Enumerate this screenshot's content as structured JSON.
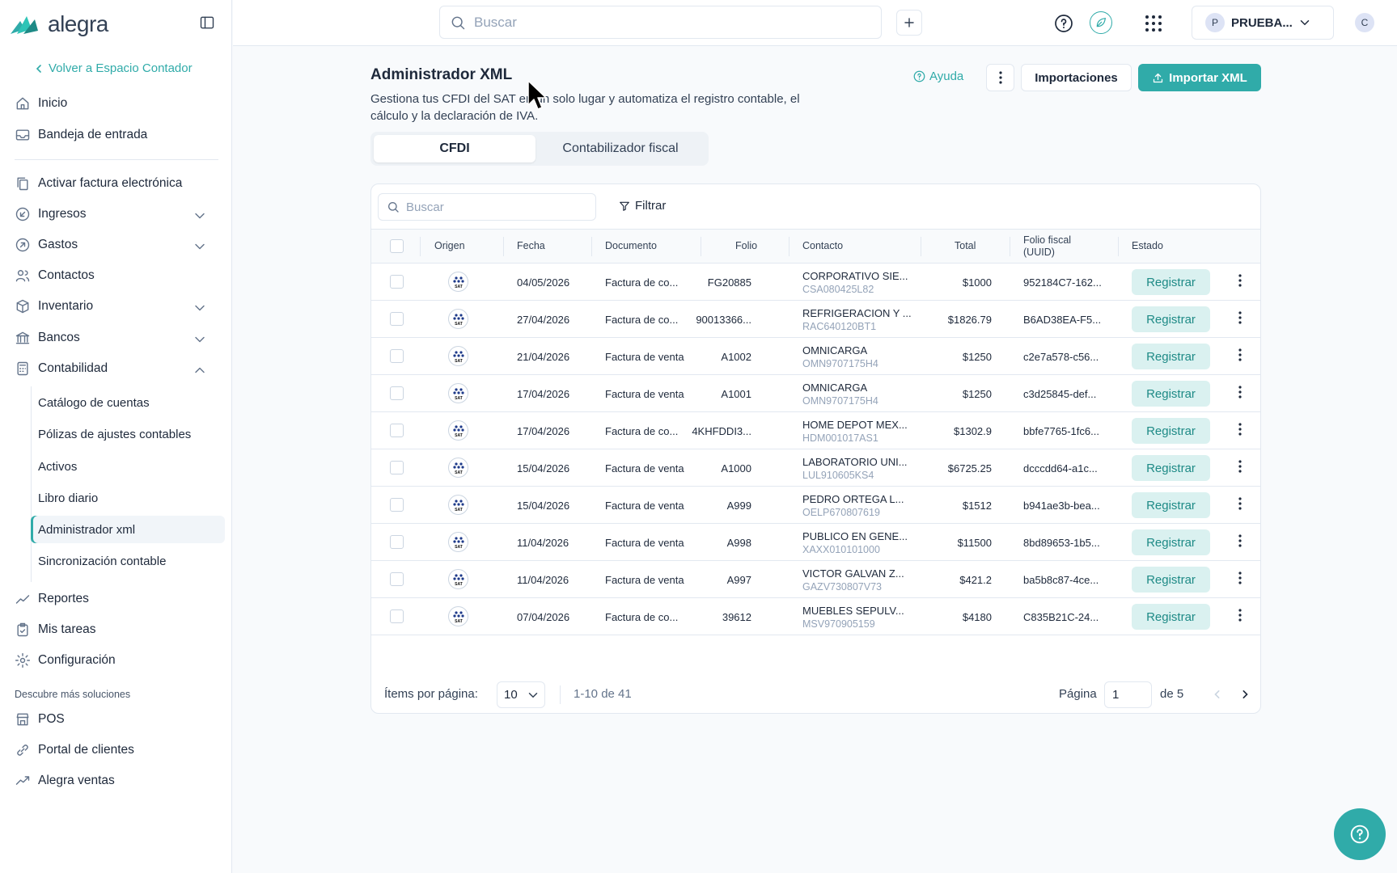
{
  "app": {
    "logo_text": "alegra"
  },
  "sidebar": {
    "back_link": "Volver a Espacio Contador",
    "top_items": [
      {
        "label": "Inicio",
        "icon": "home-icon"
      },
      {
        "label": "Bandeja de entrada",
        "icon": "inbox-icon"
      }
    ],
    "items": [
      {
        "label": "Activar factura electrónica",
        "icon": "document-copy-icon"
      },
      {
        "label": "Ingresos",
        "icon": "income-icon"
      },
      {
        "label": "Gastos",
        "icon": "expense-icon"
      },
      {
        "label": "Contactos",
        "icon": "contacts-icon"
      },
      {
        "label": "Inventario",
        "icon": "box-icon"
      },
      {
        "label": "Bancos",
        "icon": "bank-icon"
      },
      {
        "label": "Contabilidad",
        "icon": "calculator-icon"
      }
    ],
    "accounting_sub": [
      {
        "label": "Catálogo de cuentas"
      },
      {
        "label": "Pólizas de ajustes contables"
      },
      {
        "label": "Activos"
      },
      {
        "label": "Libro diario"
      },
      {
        "label": "Administrador xml",
        "active": true
      },
      {
        "label": "Sincronización contable"
      }
    ],
    "bottom_items": [
      {
        "label": "Reportes",
        "icon": "chart-icon"
      },
      {
        "label": "Mis tareas",
        "icon": "clipboard-icon"
      },
      {
        "label": "Configuración",
        "icon": "gear-icon"
      }
    ],
    "discover_label": "Descubre más soluciones",
    "solutions": [
      {
        "label": "POS",
        "icon": "store-icon"
      },
      {
        "label": "Portal de clientes",
        "icon": "link-icon"
      },
      {
        "label": "Alegra ventas",
        "icon": "trend-icon"
      }
    ]
  },
  "topbar": {
    "search_placeholder": "Buscar",
    "company_initial": "P",
    "company_name": "PRUEBA...",
    "user_initial": "C"
  },
  "page": {
    "title": "Administrador XML",
    "description": "Gestiona tus CFDI del SAT en un solo lugar y automatiza el registro contable, el cálculo y la declaración de IVA.",
    "help_label": "Ayuda",
    "imports_label": "Importaciones",
    "import_xml_label": "Importar XML"
  },
  "tabs": [
    {
      "label": "CFDI",
      "active": true
    },
    {
      "label": "Contabilizador fiscal",
      "active": false
    }
  ],
  "table": {
    "search_placeholder": "Buscar",
    "filter_label": "Filtrar",
    "columns": {
      "origen": "Origen",
      "fecha": "Fecha",
      "documento": "Documento",
      "folio": "Folio",
      "contacto": "Contacto",
      "total": "Total",
      "uuid_line1": "Folio fiscal",
      "uuid_line2": "(UUID)",
      "estado": "Estado"
    },
    "origin_badge": "SAT",
    "rows": [
      {
        "fecha": "04/05/2026",
        "documento": "Factura de co...",
        "folio": "FG20885",
        "contacto": "CORPORATIVO SIE...",
        "rfc": "CSA080425L82",
        "total": "$1000",
        "uuid": "952184C7-162...",
        "estado": "Registrar"
      },
      {
        "fecha": "27/04/2026",
        "documento": "Factura de co...",
        "folio": "90013366...",
        "contacto": "REFRIGERACION Y ...",
        "rfc": "RAC640120BT1",
        "total": "$1826.79",
        "uuid": "B6AD38EA-F5...",
        "estado": "Registrar"
      },
      {
        "fecha": "21/04/2026",
        "documento": "Factura de venta",
        "folio": "A1002",
        "contacto": "OMNICARGA",
        "rfc": "OMN9707175H4",
        "total": "$1250",
        "uuid": "c2e7a578-c56...",
        "estado": "Registrar"
      },
      {
        "fecha": "17/04/2026",
        "documento": "Factura de venta",
        "folio": "A1001",
        "contacto": "OMNICARGA",
        "rfc": "OMN9707175H4",
        "total": "$1250",
        "uuid": "c3d25845-def...",
        "estado": "Registrar"
      },
      {
        "fecha": "17/04/2026",
        "documento": "Factura de co...",
        "folio": "4KHFDDI3...",
        "contacto": "HOME DEPOT MEX...",
        "rfc": "HDM001017AS1",
        "total": "$1302.9",
        "uuid": "bbfe7765-1fc6...",
        "estado": "Registrar"
      },
      {
        "fecha": "15/04/2026",
        "documento": "Factura de venta",
        "folio": "A1000",
        "contacto": "LABORATORIO UNI...",
        "rfc": "LUL910605KS4",
        "total": "$6725.25",
        "uuid": "dcccdd64-a1c...",
        "estado": "Registrar"
      },
      {
        "fecha": "15/04/2026",
        "documento": "Factura de venta",
        "folio": "A999",
        "contacto": "PEDRO ORTEGA L...",
        "rfc": "OELP670807619",
        "total": "$1512",
        "uuid": "b941ae3b-bea...",
        "estado": "Registrar"
      },
      {
        "fecha": "11/04/2026",
        "documento": "Factura de venta",
        "folio": "A998",
        "contacto": "PUBLICO EN GENE...",
        "rfc": "XAXX010101000",
        "total": "$11500",
        "uuid": "8bd89653-1b5...",
        "estado": "Registrar"
      },
      {
        "fecha": "11/04/2026",
        "documento": "Factura de venta",
        "folio": "A997",
        "contacto": "VICTOR GALVAN Z...",
        "rfc": "GAZV730807V73",
        "total": "$421.2",
        "uuid": "ba5b8c87-4ce...",
        "estado": "Registrar"
      },
      {
        "fecha": "07/04/2026",
        "documento": "Factura de co...",
        "folio": "39612",
        "contacto": "MUEBLES SEPULV...",
        "rfc": "MSV970905159",
        "total": "$4180",
        "uuid": "C835B21C-24...",
        "estado": "Registrar"
      }
    ]
  },
  "pagination": {
    "items_per_page_label": "Ítems por página:",
    "items_per_page": "10",
    "range": "1-10 de 41",
    "page_label": "Página",
    "current_page": "1",
    "of_pages": "de 5"
  },
  "colors": {
    "accent": "#30aba9",
    "register_bg": "#daf1f0",
    "register_text": "#1e8a86"
  }
}
